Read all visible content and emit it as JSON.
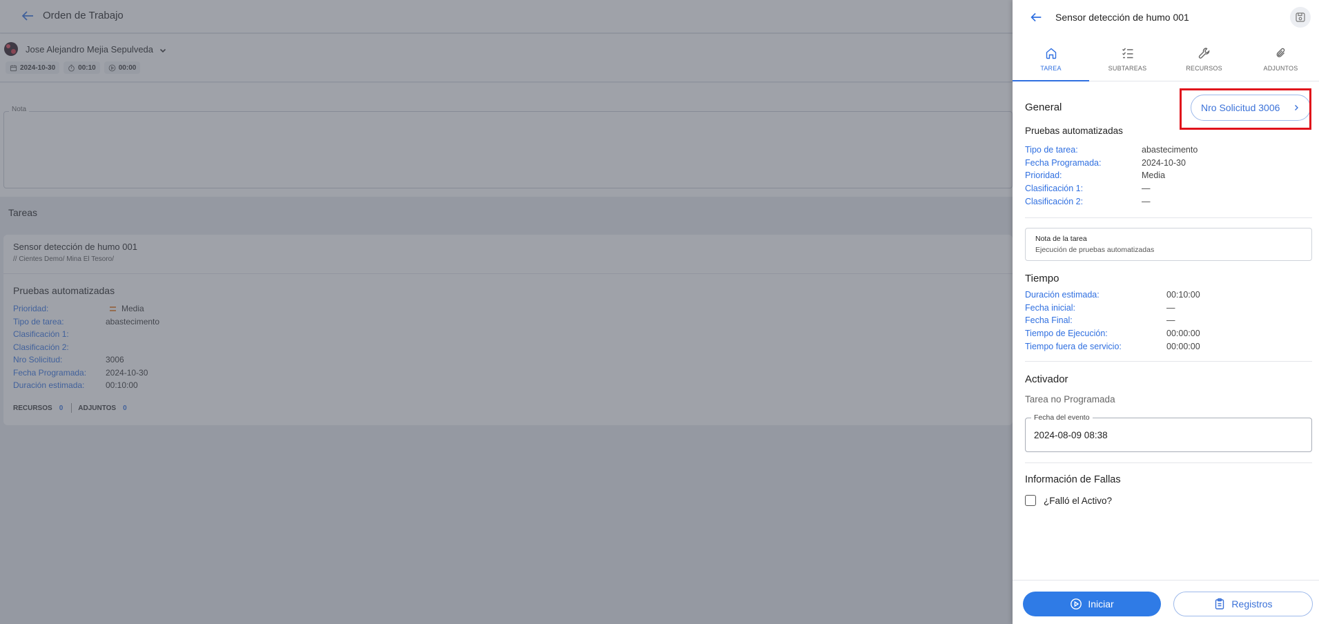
{
  "background": {
    "header_title": "Orden de Trabajo",
    "user_name": "Jose Alejandro Mejia Sepulveda",
    "chips": [
      {
        "icon": "calendar-icon",
        "text": "2024-10-30"
      },
      {
        "icon": "timer-icon",
        "text": "00:10"
      },
      {
        "icon": "play-circle-icon",
        "text": "00:00"
      }
    ],
    "note_label": "Nota",
    "tareas_title": "Tareas",
    "task": {
      "name": "Sensor detección de humo 001",
      "path": "// Cientes Demo/ Mina El Tesoro/",
      "subtitle": "Pruebas automatizadas",
      "fields": [
        {
          "k": "Prioridad:",
          "v": "Media"
        },
        {
          "k": "Tipo de tarea:",
          "v": "abastecimento"
        },
        {
          "k": "Clasificación 1:",
          "v": ""
        },
        {
          "k": "Clasificación 2:",
          "v": ""
        },
        {
          "k": "Nro Solicitud:",
          "v": "3006"
        },
        {
          "k": "Fecha Programada:",
          "v": "2024-10-30"
        },
        {
          "k": "Duración estimada:",
          "v": "00:10:00"
        }
      ],
      "footer": {
        "recursos_label": "RECURSOS",
        "recursos_count": "0",
        "adjuntos_label": "ADJUNTOS",
        "adjuntos_count": "0"
      }
    }
  },
  "panel": {
    "title": "Sensor detección de humo 001",
    "tabs": [
      {
        "label": "TAREA",
        "icon": "home-icon",
        "active": true
      },
      {
        "label": "SUBTAREAS",
        "icon": "checklist-icon",
        "active": false
      },
      {
        "label": "RECURSOS",
        "icon": "wrench-icon",
        "active": false
      },
      {
        "label": "ADJUNTOS",
        "icon": "paperclip-icon",
        "active": false
      }
    ],
    "general_title": "General",
    "solicitud_button": "Nro Solicitud 3006",
    "subtitle": "Pruebas automatizadas",
    "general_fields": [
      {
        "k": "Tipo de tarea:",
        "v": "abastecimento"
      },
      {
        "k": "Fecha Programada:",
        "v": "2024-10-30"
      },
      {
        "k": "Prioridad:",
        "v": "Media"
      },
      {
        "k": "Clasificación 1:",
        "v": "—"
      },
      {
        "k": "Clasificación 2:",
        "v": "—"
      }
    ],
    "task_note": {
      "label": "Nota de la tarea",
      "value": "Ejecución de pruebas automatizadas"
    },
    "tiempo_title": "Tiempo",
    "tiempo_fields": [
      {
        "k": "Duración estimada:",
        "v": "00:10:00"
      },
      {
        "k": "Fecha inicial:",
        "v": "—"
      },
      {
        "k": "Fecha Final:",
        "v": "—"
      },
      {
        "k": "Tiempo de Ejecución:",
        "v": "00:00:00"
      },
      {
        "k": "Tiempo fuera de servicio:",
        "v": "00:00:00"
      }
    ],
    "activador_title": "Activador",
    "activador_text": "Tarea no Programada",
    "event_label": "Fecha del evento",
    "event_value": "2024-08-09 08:38",
    "fallas_title": "Información de Fallas",
    "fallas_checkbox": "¿Falló el Activo?",
    "btn_iniciar": "Iniciar",
    "btn_registros": "Registros"
  },
  "colors": {
    "accent": "#2f6fe0",
    "highlight": "#e0121b"
  }
}
